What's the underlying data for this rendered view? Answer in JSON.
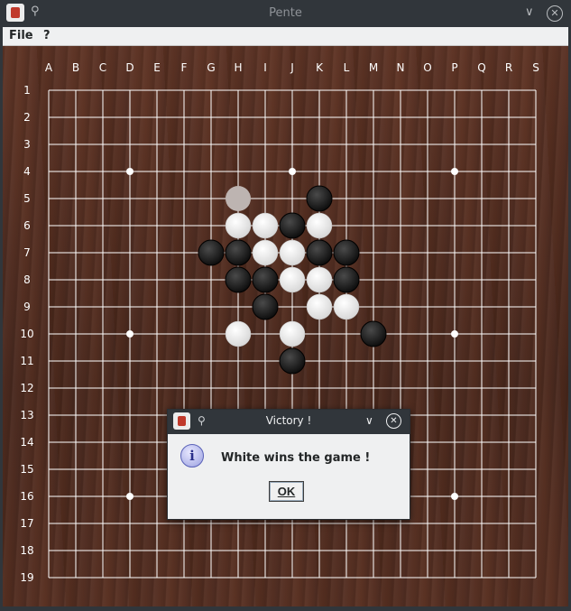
{
  "window": {
    "title": "Pente",
    "app_icon": "pente-app-icon",
    "pin_icon": "pin-icon",
    "minimize_glyph": "∨",
    "close_glyph": "✕"
  },
  "menubar": {
    "items": [
      "File",
      "?"
    ]
  },
  "board": {
    "columns": [
      "A",
      "B",
      "C",
      "D",
      "E",
      "F",
      "G",
      "H",
      "I",
      "J",
      "K",
      "L",
      "M",
      "N",
      "O",
      "P",
      "Q",
      "R",
      "S"
    ],
    "rows": [
      "1",
      "2",
      "3",
      "4",
      "5",
      "6",
      "7",
      "8",
      "9",
      "10",
      "11",
      "12",
      "13",
      "14",
      "15",
      "16",
      "17",
      "18",
      "19"
    ],
    "line_color": "#ffffff",
    "star_points": [
      "D4",
      "J4",
      "P4",
      "D10",
      "P10",
      "D16",
      "P16"
    ],
    "stones": [
      {
        "pos": "H5",
        "color": "white-faded"
      },
      {
        "pos": "K5",
        "color": "black"
      },
      {
        "pos": "H6",
        "color": "white"
      },
      {
        "pos": "I6",
        "color": "white"
      },
      {
        "pos": "J6",
        "color": "black"
      },
      {
        "pos": "K6",
        "color": "white"
      },
      {
        "pos": "G7",
        "color": "black"
      },
      {
        "pos": "H7",
        "color": "black"
      },
      {
        "pos": "I7",
        "color": "white"
      },
      {
        "pos": "J7",
        "color": "white"
      },
      {
        "pos": "K7",
        "color": "black"
      },
      {
        "pos": "L7",
        "color": "black"
      },
      {
        "pos": "H8",
        "color": "black"
      },
      {
        "pos": "I8",
        "color": "black"
      },
      {
        "pos": "J8",
        "color": "white"
      },
      {
        "pos": "K8",
        "color": "white"
      },
      {
        "pos": "L8",
        "color": "black"
      },
      {
        "pos": "I9",
        "color": "black"
      },
      {
        "pos": "K9",
        "color": "white"
      },
      {
        "pos": "L9",
        "color": "white"
      },
      {
        "pos": "H10",
        "color": "white"
      },
      {
        "pos": "J10",
        "color": "white"
      },
      {
        "pos": "M10",
        "color": "black"
      },
      {
        "pos": "J11",
        "color": "black"
      }
    ]
  },
  "dialog": {
    "title": "Victory !",
    "icon": "information-icon",
    "icon_glyph": "i",
    "message": "White wins the game !",
    "ok_label": "OK",
    "pin_icon": "pin-icon",
    "minimize_glyph": "∨",
    "close_glyph": "✕"
  },
  "colors": {
    "titlebar": "#31363b",
    "menubar": "#eff0f1",
    "board_wood": "#4e2c22",
    "black_stone": "#161616",
    "white_stone": "#f2f2f2"
  }
}
